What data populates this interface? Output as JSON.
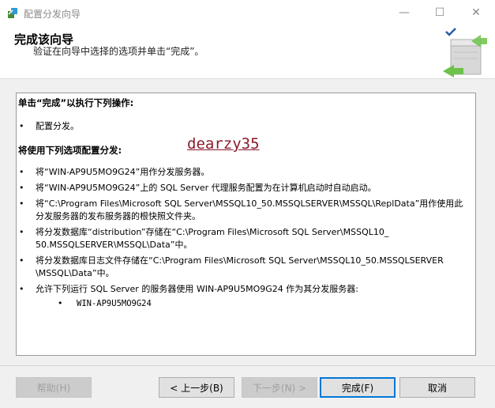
{
  "window": {
    "title": "配置分发向导",
    "minimize": "—",
    "maximize": "☐",
    "close": "✕"
  },
  "header": {
    "title": "完成该向导",
    "subtitle": "验证在向导中选择的选项并单击“完成”。"
  },
  "content": {
    "section1_title": "单击“完成”以执行下列操作:",
    "section1_items": [
      "配置分发。"
    ],
    "section2_title": "将使用下列选项配置分发:",
    "section2_items": [
      "将“WIN-AP9U5MO9G24”用作分发服务器。",
      "将“WIN-AP9U5MO9G24”上的 SQL Server 代理服务配置为在计算机启动时自动启动。",
      "将“C:\\Program Files\\Microsoft SQL Server\\MSSQL10_50.MSSQLSERVER\\MSSQL\\ReplData”用作使用此分发服务器的发布服务器的根快照文件夹。",
      "将分发数据库“distribution”存储在“C:\\Program Files\\Microsoft SQL Server\\MSSQL10_ 50.MSSQLSERVER\\MSSQL\\Data”中。",
      "将分发数据库日志文件存储在“C:\\Program Files\\Microsoft SQL Server\\MSSQL10_50.MSSQLSERVER \\MSSQL\\Data”中。",
      "允许下列运行 SQL Server 的服务器使用 WIN-AP9U5MO9G24 作为其分发服务器:"
    ],
    "subitem": "WIN-AP9U5MO9G24",
    "bullet": "•",
    "watermark": "dearzy35"
  },
  "buttons": {
    "help": "帮助(H)",
    "back": "< 上一步(B)",
    "next": "下一步(N) >",
    "finish": "完成(F)",
    "cancel": "取消"
  },
  "colors": {
    "accent": "#0078d7",
    "watermark": "#8b1a2b"
  }
}
